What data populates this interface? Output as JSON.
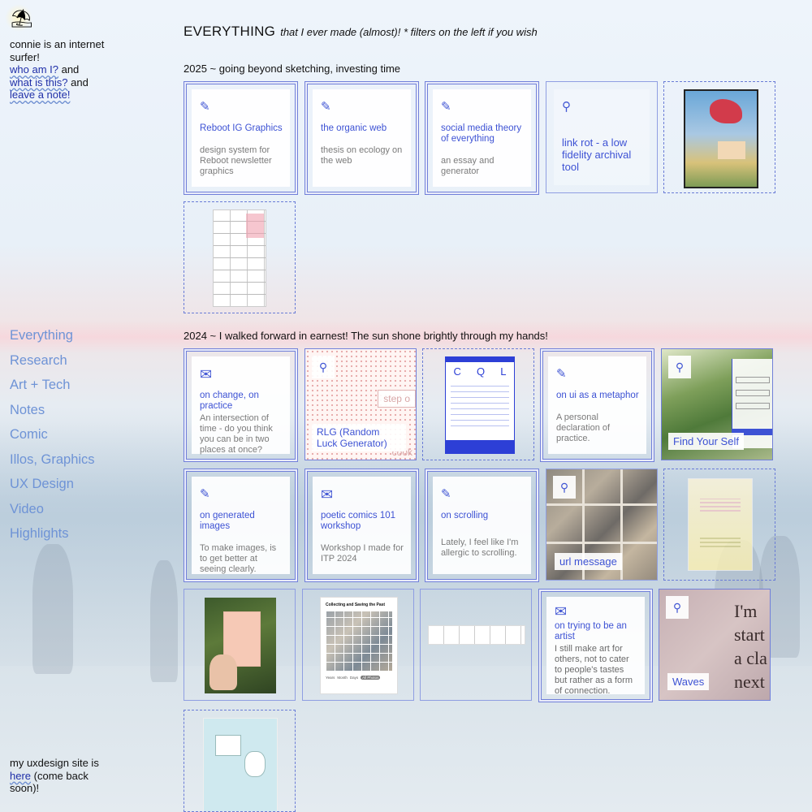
{
  "sidebar": {
    "intro_text": "connie is an internet surfer!",
    "link_who": "who am I?",
    "link_what": "what is this?",
    "link_note": "leave a note!",
    "and_1": " and",
    "and_2": " and",
    "nav": [
      "Everything",
      "Research",
      "Art + Tech",
      "Notes",
      "Comic",
      "Illos, Graphics",
      "UX Design",
      "Video",
      "Highlights"
    ],
    "footer_prefix": "my uxdesign site is",
    "footer_link": "here",
    "footer_suffix": " (come back soon)!"
  },
  "header": {
    "title": "EVERYTHING",
    "subtitle": "that I ever made (almost)! * filters on the left if you wish"
  },
  "sections": {
    "s2025": "2025 ~ going beyond sketching, investing time",
    "s2024": "2024 ~ I walked forward in earnest! The sun shone brightly through my hands!"
  },
  "icons": {
    "pencil": "pencil-icon",
    "pin": "pin-icon",
    "mail": "mail-icon",
    "umbrella": "beach-umbrella-icon"
  },
  "cards": {
    "reboot": {
      "title": "Reboot IG Graphics",
      "desc": "design system for Reboot newsletter graphics"
    },
    "organic": {
      "title": "the organic web",
      "desc": "thesis on ecology on the web"
    },
    "smt": {
      "title": "social media theory of everything",
      "desc": "an essay and generator"
    },
    "linkrot": {
      "title": "link rot - a low fidelity archival tool"
    },
    "change": {
      "title": "on change, on practice",
      "desc": "An intersection of time - do you think you can be in two places at once?"
    },
    "rlg": {
      "title": "RLG (Random Luck Generator)",
      "overlay1": "step o",
      "overlay2": "cook"
    },
    "cql": {
      "letters": [
        "C",
        "Q",
        "L"
      ]
    },
    "ui": {
      "title": "on ui as a metaphor",
      "desc": "A personal declaration of practice."
    },
    "findself": {
      "title": "Find Your Self"
    },
    "generated": {
      "title": "on generated images",
      "desc": "To make images, is to get better at seeing clearly."
    },
    "poetic": {
      "title": "poetic comics 101 workshop",
      "desc": "Workshop I made for ITP 2024"
    },
    "scrolling": {
      "title": "on scrolling",
      "desc": "Lately, I feel like I'm allergic to scrolling."
    },
    "url": {
      "title": "url message"
    },
    "collecting": {
      "heading": "Collecting and Saving the Past",
      "tabs": [
        "Years",
        "Month",
        "Days",
        "All Photos"
      ]
    },
    "artist": {
      "title": "on trying to be an artist",
      "desc": "I still make art for others, not to cater to people's tastes but rather as a form of connection."
    },
    "waves": {
      "title": "Waves",
      "bigtext": [
        "I'm",
        "start",
        "a cla",
        "next"
      ]
    }
  },
  "colors": {
    "accent": "#3d52d4",
    "border": "#7180d9",
    "nav": "#6e93d6"
  }
}
